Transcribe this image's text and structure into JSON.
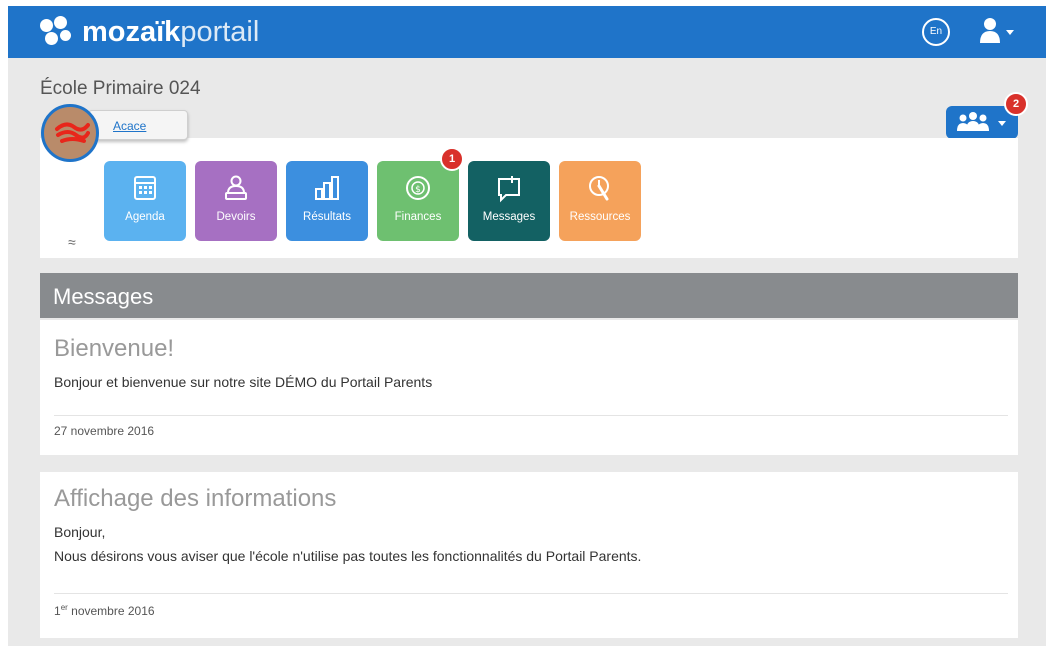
{
  "header": {
    "logo_bold": "mozaïk",
    "logo_light": "portail",
    "language_button": "En",
    "brand_color": "#1f74c9"
  },
  "school": {
    "name": "École Primaire 024"
  },
  "student": {
    "name": "Acace"
  },
  "children_badge": "2",
  "tiles": [
    {
      "label": "Agenda",
      "color": "#5bb2f0",
      "icon": "calendar-icon"
    },
    {
      "label": "Devoirs",
      "color": "#a670c2",
      "icon": "homework-icon"
    },
    {
      "label": "Résultats",
      "color": "#3c8fdf",
      "icon": "bar-chart-icon"
    },
    {
      "label": "Finances",
      "color": "#6ec070",
      "icon": "coin-icon",
      "badge": "1"
    },
    {
      "label": "Messages",
      "color": "#136163",
      "icon": "message-icon"
    },
    {
      "label": "Ressources",
      "color": "#f5a25b",
      "icon": "resources-icon"
    }
  ],
  "messages": {
    "title": "Messages",
    "items": [
      {
        "title": "Bienvenue!",
        "body": [
          "Bonjour et bienvenue sur notre site DÉMO du Portail Parents"
        ],
        "date": "27 novembre 2016"
      },
      {
        "title": "Affichage des informations",
        "body": [
          "Bonjour,",
          "Nous désirons vous aviser que l'école n'utilise pas toutes les fonctionnalités du Portail Parents."
        ],
        "date_day": "1",
        "date_sup": "er",
        "date_rest": " novembre 2016"
      }
    ]
  }
}
